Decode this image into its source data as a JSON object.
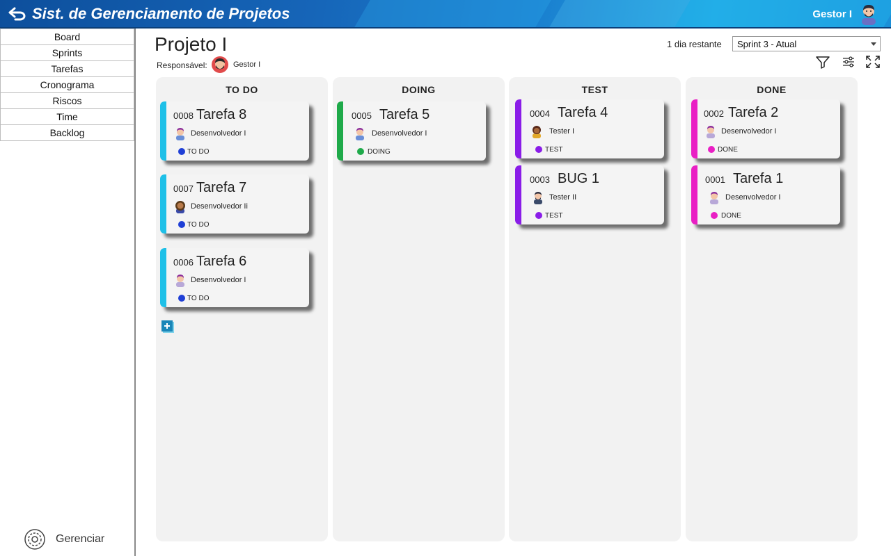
{
  "header": {
    "title": "Sist. de Gerenciamento de Projetos",
    "user_name": "Gestor I"
  },
  "sidebar": {
    "items": [
      {
        "label": "Board"
      },
      {
        "label": "Sprints"
      },
      {
        "label": "Tarefas"
      },
      {
        "label": "Cronograma"
      },
      {
        "label": "Riscos"
      },
      {
        "label": "Time"
      },
      {
        "label": "Backlog"
      }
    ],
    "manage_label": "Gerenciar"
  },
  "project": {
    "title": "Projeto I",
    "responsible_label": "Responsável:",
    "responsible_name": "Gestor I",
    "days_left": "1 dia restante",
    "sprint_selected": "Sprint 3 - Atual"
  },
  "columns": [
    {
      "title": "TO DO"
    },
    {
      "title": "DOING"
    },
    {
      "title": "TEST"
    },
    {
      "title": "DONE"
    }
  ],
  "cards": [
    {
      "code": "0008",
      "name": "Tarefa 8",
      "assignee": "Desenvolvedor I",
      "status": "TO DO"
    },
    {
      "code": "0007",
      "name": "Tarefa 7",
      "assignee": "Desenvolvedor Ii",
      "status": "TO DO"
    },
    {
      "code": "0006",
      "name": "Tarefa 6",
      "assignee": "Desenvolvedor I",
      "status": "TO DO"
    },
    {
      "code": "0005",
      "name": "Tarefa 5",
      "assignee": "Desenvolvedor I",
      "status": "DOING"
    },
    {
      "code": "0004",
      "name": "Tarefa 4",
      "assignee": "Tester I",
      "status": "TEST"
    },
    {
      "code": "0003",
      "name": "BUG 1",
      "assignee": "Tester II",
      "status": "TEST"
    },
    {
      "code": "0002",
      "name": "Tarefa 2",
      "assignee": "Desenvolvedor I",
      "status": "DONE"
    },
    {
      "code": "0001",
      "name": "Tarefa 1",
      "assignee": "Desenvolvedor I",
      "status": "DONE"
    }
  ],
  "colors": {
    "todo_bar": "#1ec0e8",
    "todo_dot": "#1f3fd6",
    "doing": "#1faa4a",
    "test": "#8a1de8",
    "done": "#e91fc4"
  }
}
